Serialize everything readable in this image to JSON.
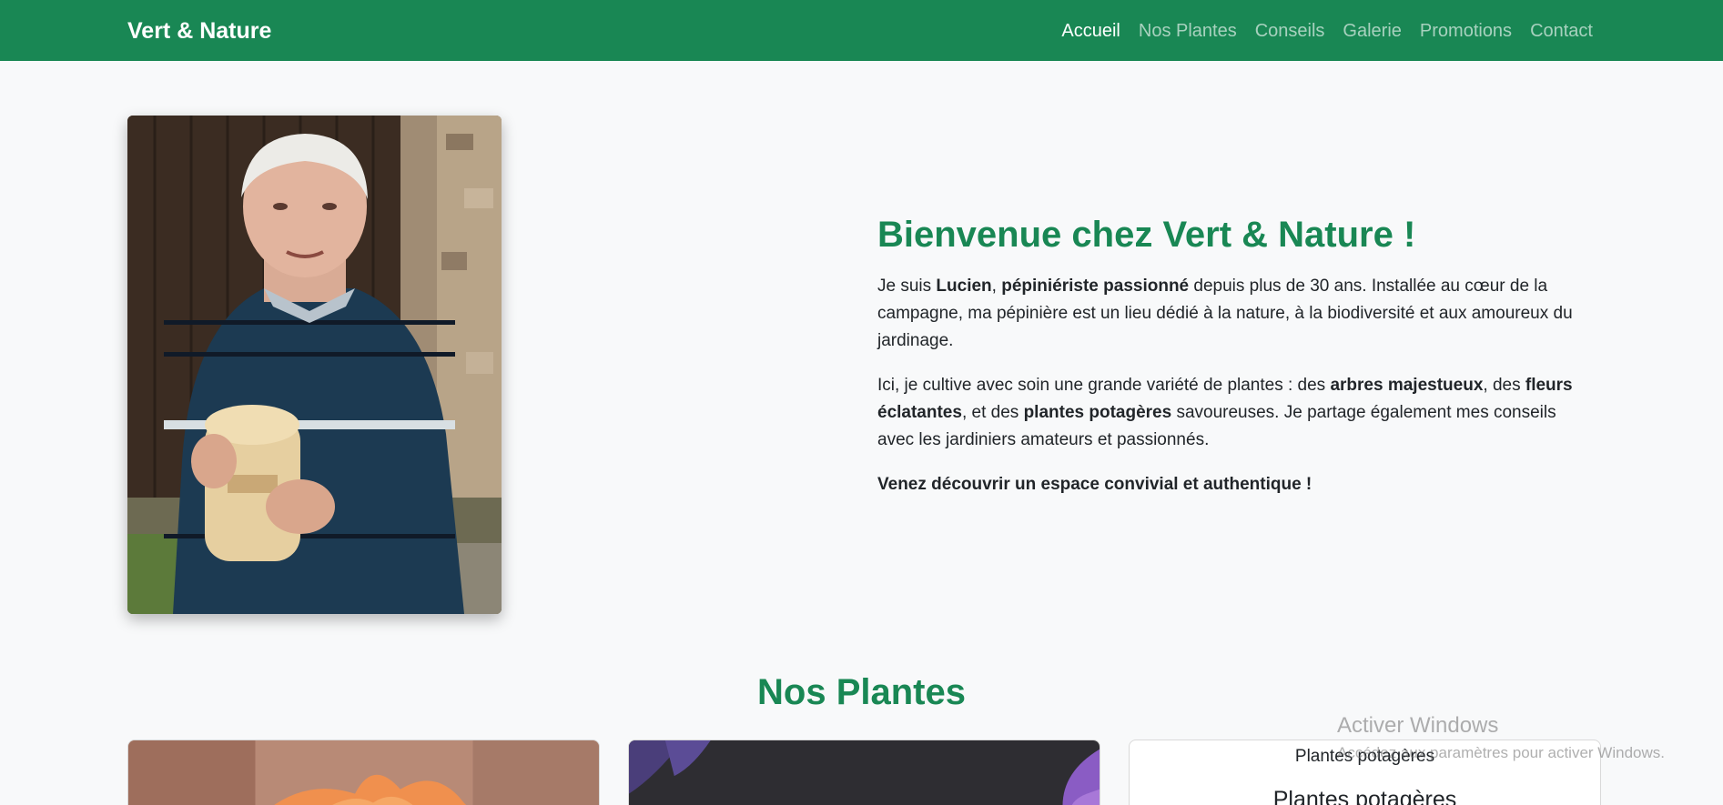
{
  "navbar": {
    "brand": "Vert & Nature",
    "links": [
      {
        "label": "Accueil",
        "active": true
      },
      {
        "label": "Nos Plantes",
        "active": false
      },
      {
        "label": "Conseils",
        "active": false
      },
      {
        "label": "Galerie",
        "active": false
      },
      {
        "label": "Promotions",
        "active": false
      },
      {
        "label": "Contact",
        "active": false
      }
    ]
  },
  "hero": {
    "title": "Bienvenue chez Vert & Nature !",
    "p1": {
      "t1": "Je suis ",
      "b1": "Lucien",
      "t2": ", ",
      "b2": "pépiniériste passionné",
      "t3": " depuis plus de 30 ans. Installée au cœur de la campagne, ma pépinière est un lieu dédié à la nature, à la biodiversité et aux amoureux du jardinage."
    },
    "p2": {
      "t1": "Ici, je cultive avec soin une grande variété de plantes : des ",
      "b1": "arbres majestueux",
      "t2": ", des ",
      "b2": "fleurs éclatantes",
      "t3": ", et des ",
      "b3": "plantes potagères",
      "t4": " savoureuses. Je partage également mes conseils avec les jardiniers amateurs et passionnés."
    },
    "p3": "Venez découvrir un espace convivial et authentique !"
  },
  "plants": {
    "title": "Nos Plantes",
    "card3_alt": "Plantes potagères",
    "card3_title": "Plantes potagères"
  },
  "watermark": {
    "line1": "Activer Windows",
    "line2": "Accédez aux paramètres pour activer Windows."
  },
  "colors": {
    "brand_green": "#198754",
    "background": "#f8f9fa"
  }
}
